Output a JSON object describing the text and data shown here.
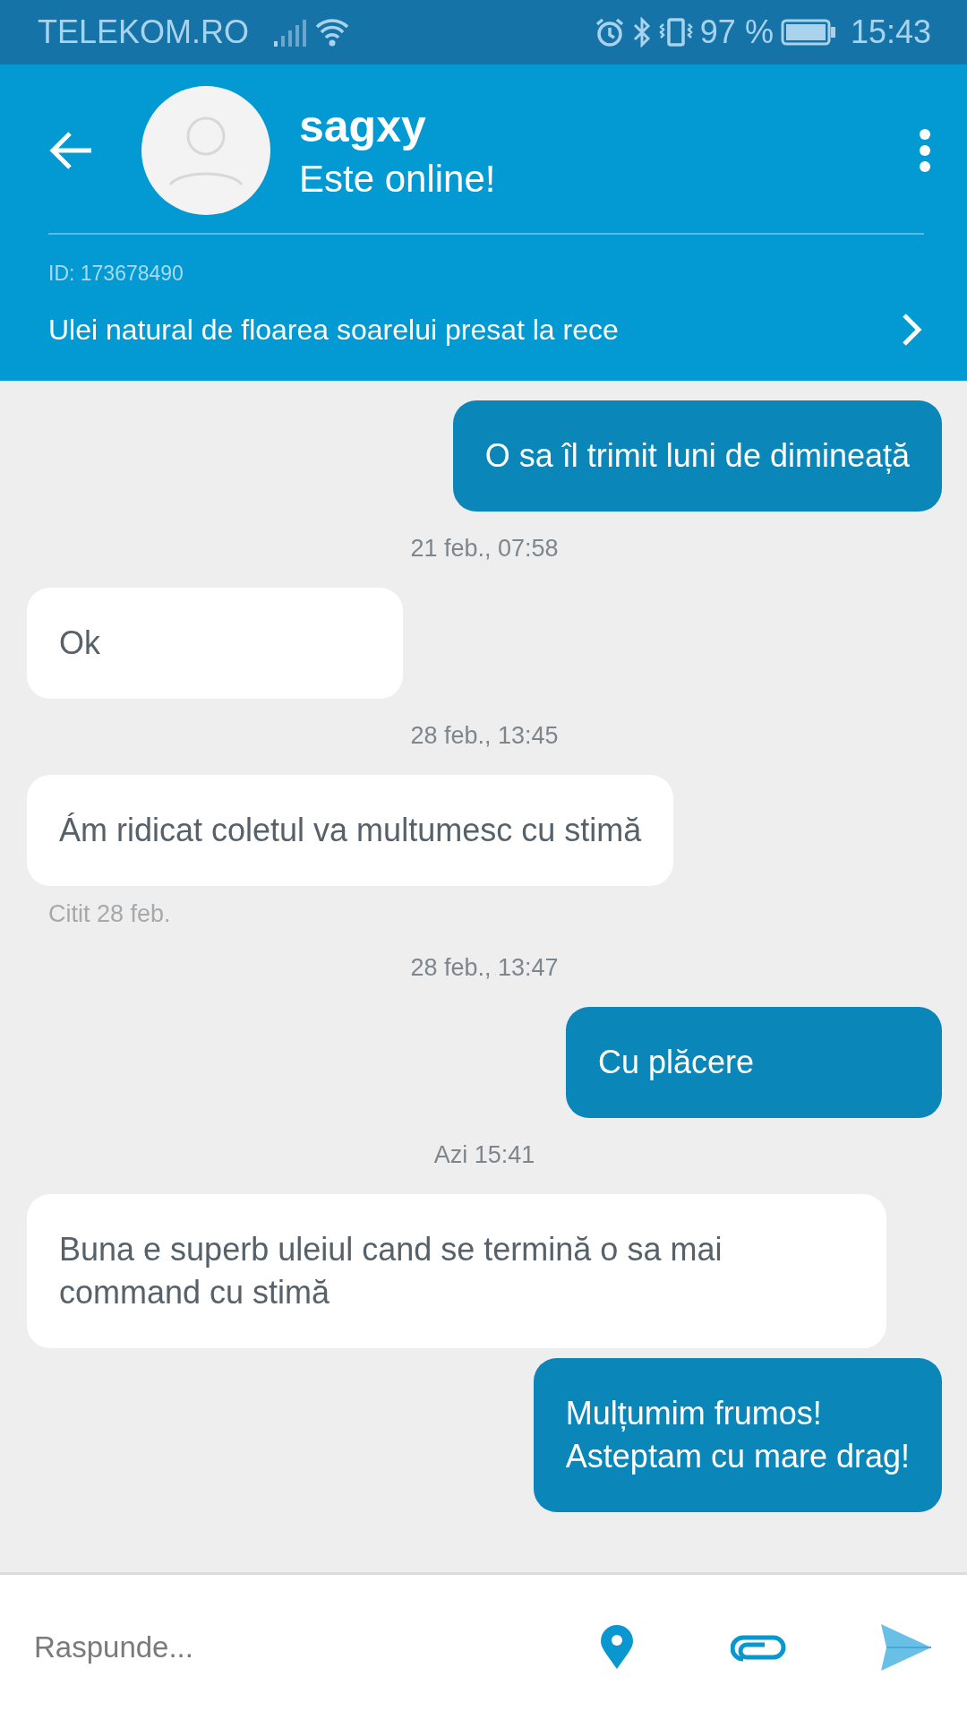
{
  "status_bar": {
    "carrier": "TELEKOM.RO",
    "battery": "97 %",
    "time": "15:43"
  },
  "header": {
    "name": "sagxy",
    "status": "Este online!",
    "id_label": "ID: 173678490",
    "product": "Ulei natural de floarea soarelui presat la rece"
  },
  "messages": [
    {
      "kind": "outgoing",
      "text": "O sa îl trimit luni de dimineață"
    },
    {
      "kind": "timestamp",
      "text": "21 feb., 07:58"
    },
    {
      "kind": "incoming",
      "text": "Ok"
    },
    {
      "kind": "timestamp",
      "text": "28 feb., 13:45"
    },
    {
      "kind": "incoming",
      "text": "Ám ridicat coletul va multumesc cu stimă"
    },
    {
      "kind": "receipt",
      "text": "Citit 28 feb."
    },
    {
      "kind": "timestamp",
      "text": "28 feb., 13:47"
    },
    {
      "kind": "outgoing",
      "text": "Cu plăcere"
    },
    {
      "kind": "timestamp",
      "text": "Azi 15:41"
    },
    {
      "kind": "incoming",
      "text": "Buna e superb uleiul cand se termină o sa mai command cu stimă"
    },
    {
      "kind": "outgoing",
      "text": "Mulțumim frumos!\nAsteptam cu mare drag!"
    }
  ],
  "reply": {
    "placeholder": "Raspunde..."
  }
}
